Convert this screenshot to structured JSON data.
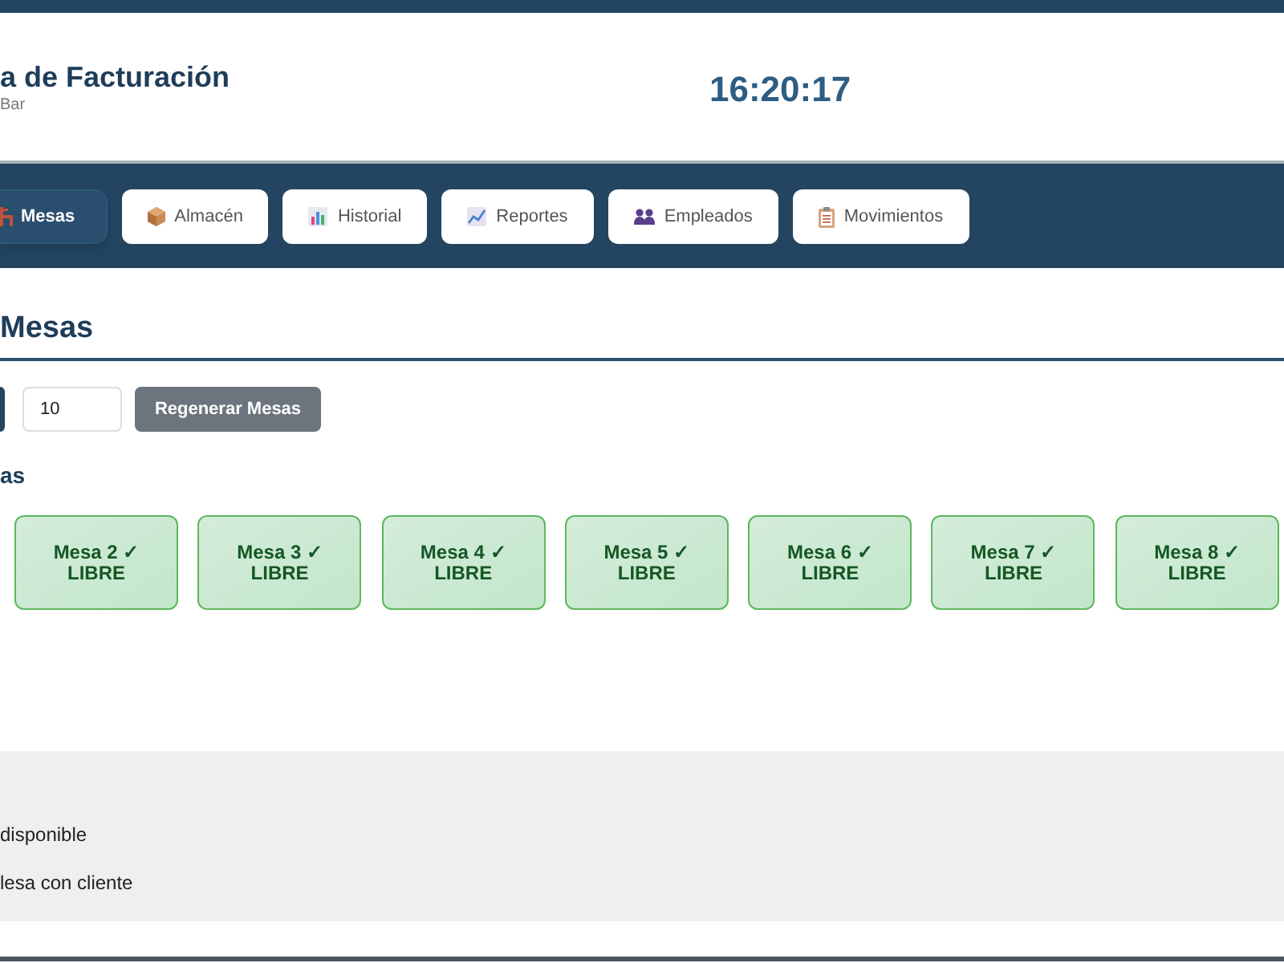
{
  "header": {
    "title": "a de Facturación",
    "subtitle": "Bar",
    "clock": "16:20:17"
  },
  "nav_tabs": [
    {
      "label": "Mesas",
      "selected": true
    },
    {
      "label": "Almacén",
      "selected": false
    },
    {
      "label": "Historial",
      "selected": false
    },
    {
      "label": "Reportes",
      "selected": false
    },
    {
      "label": "Empleados",
      "selected": false
    },
    {
      "label": "Movimientos",
      "selected": false
    }
  ],
  "section": {
    "title": "Mesas",
    "table_count": {
      "value": "10"
    },
    "regenerate_button": "Regenerar Mesas",
    "subtitle": "as"
  },
  "tables": [
    {
      "name": "Mesa 2",
      "mark": "✓",
      "status": "LIBRE",
      "kind": "free"
    },
    {
      "name": "Mesa 3",
      "mark": "✓",
      "status": "LIBRE",
      "kind": "free"
    },
    {
      "name": "Mesa 4",
      "mark": "✓",
      "status": "LIBRE",
      "kind": "free"
    },
    {
      "name": "Mesa 5",
      "mark": "✓",
      "status": "LIBRE",
      "kind": "free"
    },
    {
      "name": "Mesa 6",
      "mark": "✓",
      "status": "LIBRE",
      "kind": "free"
    },
    {
      "name": "Mesa 7",
      "mark": "✓",
      "status": "LIBRE",
      "kind": "free"
    },
    {
      "name": "Mesa 8",
      "mark": "✓",
      "status": "LIBRE",
      "kind": "free"
    }
  ],
  "legend": [
    {
      "label": "disponible"
    },
    {
      "label": "lesa con cliente"
    }
  ]
}
